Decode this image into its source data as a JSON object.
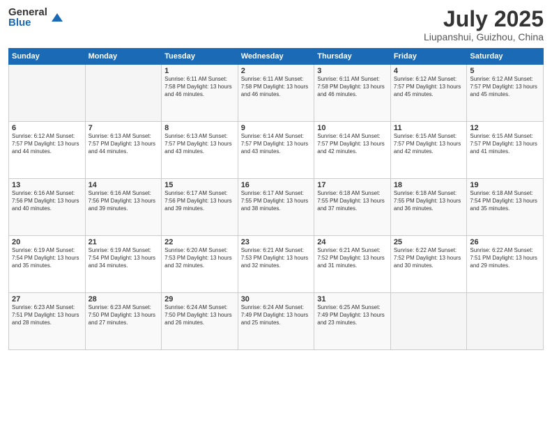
{
  "header": {
    "logo_general": "General",
    "logo_blue": "Blue",
    "title": "July 2025",
    "subtitle": "Liupanshui, Guizhou, China"
  },
  "weekdays": [
    "Sunday",
    "Monday",
    "Tuesday",
    "Wednesday",
    "Thursday",
    "Friday",
    "Saturday"
  ],
  "weeks": [
    [
      {
        "day": "",
        "info": ""
      },
      {
        "day": "",
        "info": ""
      },
      {
        "day": "1",
        "info": "Sunrise: 6:11 AM\nSunset: 7:58 PM\nDaylight: 13 hours and 46 minutes."
      },
      {
        "day": "2",
        "info": "Sunrise: 6:11 AM\nSunset: 7:58 PM\nDaylight: 13 hours and 46 minutes."
      },
      {
        "day": "3",
        "info": "Sunrise: 6:11 AM\nSunset: 7:58 PM\nDaylight: 13 hours and 46 minutes."
      },
      {
        "day": "4",
        "info": "Sunrise: 6:12 AM\nSunset: 7:57 PM\nDaylight: 13 hours and 45 minutes."
      },
      {
        "day": "5",
        "info": "Sunrise: 6:12 AM\nSunset: 7:57 PM\nDaylight: 13 hours and 45 minutes."
      }
    ],
    [
      {
        "day": "6",
        "info": "Sunrise: 6:12 AM\nSunset: 7:57 PM\nDaylight: 13 hours and 44 minutes."
      },
      {
        "day": "7",
        "info": "Sunrise: 6:13 AM\nSunset: 7:57 PM\nDaylight: 13 hours and 44 minutes."
      },
      {
        "day": "8",
        "info": "Sunrise: 6:13 AM\nSunset: 7:57 PM\nDaylight: 13 hours and 43 minutes."
      },
      {
        "day": "9",
        "info": "Sunrise: 6:14 AM\nSunset: 7:57 PM\nDaylight: 13 hours and 43 minutes."
      },
      {
        "day": "10",
        "info": "Sunrise: 6:14 AM\nSunset: 7:57 PM\nDaylight: 13 hours and 42 minutes."
      },
      {
        "day": "11",
        "info": "Sunrise: 6:15 AM\nSunset: 7:57 PM\nDaylight: 13 hours and 42 minutes."
      },
      {
        "day": "12",
        "info": "Sunrise: 6:15 AM\nSunset: 7:57 PM\nDaylight: 13 hours and 41 minutes."
      }
    ],
    [
      {
        "day": "13",
        "info": "Sunrise: 6:16 AM\nSunset: 7:56 PM\nDaylight: 13 hours and 40 minutes."
      },
      {
        "day": "14",
        "info": "Sunrise: 6:16 AM\nSunset: 7:56 PM\nDaylight: 13 hours and 39 minutes."
      },
      {
        "day": "15",
        "info": "Sunrise: 6:17 AM\nSunset: 7:56 PM\nDaylight: 13 hours and 39 minutes."
      },
      {
        "day": "16",
        "info": "Sunrise: 6:17 AM\nSunset: 7:55 PM\nDaylight: 13 hours and 38 minutes."
      },
      {
        "day": "17",
        "info": "Sunrise: 6:18 AM\nSunset: 7:55 PM\nDaylight: 13 hours and 37 minutes."
      },
      {
        "day": "18",
        "info": "Sunrise: 6:18 AM\nSunset: 7:55 PM\nDaylight: 13 hours and 36 minutes."
      },
      {
        "day": "19",
        "info": "Sunrise: 6:18 AM\nSunset: 7:54 PM\nDaylight: 13 hours and 35 minutes."
      }
    ],
    [
      {
        "day": "20",
        "info": "Sunrise: 6:19 AM\nSunset: 7:54 PM\nDaylight: 13 hours and 35 minutes."
      },
      {
        "day": "21",
        "info": "Sunrise: 6:19 AM\nSunset: 7:54 PM\nDaylight: 13 hours and 34 minutes."
      },
      {
        "day": "22",
        "info": "Sunrise: 6:20 AM\nSunset: 7:53 PM\nDaylight: 13 hours and 32 minutes."
      },
      {
        "day": "23",
        "info": "Sunrise: 6:21 AM\nSunset: 7:53 PM\nDaylight: 13 hours and 32 minutes."
      },
      {
        "day": "24",
        "info": "Sunrise: 6:21 AM\nSunset: 7:52 PM\nDaylight: 13 hours and 31 minutes."
      },
      {
        "day": "25",
        "info": "Sunrise: 6:22 AM\nSunset: 7:52 PM\nDaylight: 13 hours and 30 minutes."
      },
      {
        "day": "26",
        "info": "Sunrise: 6:22 AM\nSunset: 7:51 PM\nDaylight: 13 hours and 29 minutes."
      }
    ],
    [
      {
        "day": "27",
        "info": "Sunrise: 6:23 AM\nSunset: 7:51 PM\nDaylight: 13 hours and 28 minutes."
      },
      {
        "day": "28",
        "info": "Sunrise: 6:23 AM\nSunset: 7:50 PM\nDaylight: 13 hours and 27 minutes."
      },
      {
        "day": "29",
        "info": "Sunrise: 6:24 AM\nSunset: 7:50 PM\nDaylight: 13 hours and 26 minutes."
      },
      {
        "day": "30",
        "info": "Sunrise: 6:24 AM\nSunset: 7:49 PM\nDaylight: 13 hours and 25 minutes."
      },
      {
        "day": "31",
        "info": "Sunrise: 6:25 AM\nSunset: 7:49 PM\nDaylight: 13 hours and 23 minutes."
      },
      {
        "day": "",
        "info": ""
      },
      {
        "day": "",
        "info": ""
      }
    ]
  ]
}
